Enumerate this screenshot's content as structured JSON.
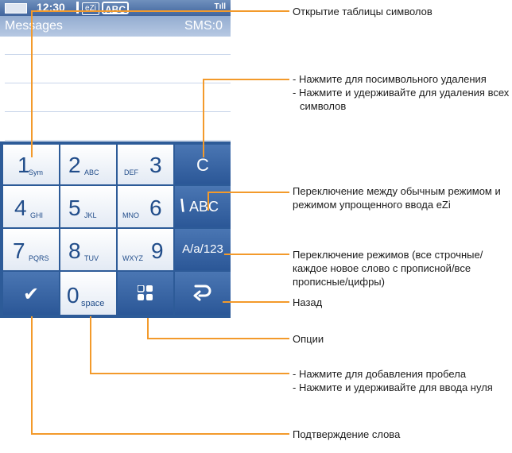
{
  "phone": {
    "status": {
      "time": "12:30",
      "ezi_badge": "eZi",
      "input_mode_badge": "ABC",
      "signal": "Tıll"
    },
    "message_bar": {
      "title": "Messages",
      "sms_counter": "SMS:0"
    }
  },
  "keypad": {
    "keys": [
      {
        "digit": "1",
        "letters": "Sym"
      },
      {
        "digit": "2",
        "letters": "ABC"
      },
      {
        "digit": "3",
        "letters": "DEF"
      },
      {
        "digit": "4",
        "letters": "GHI"
      },
      {
        "digit": "5",
        "letters": "JKL"
      },
      {
        "digit": "6",
        "letters": "MNO"
      },
      {
        "digit": "7",
        "letters": "PQRS"
      },
      {
        "digit": "8",
        "letters": "TUV"
      },
      {
        "digit": "9",
        "letters": "WXYZ"
      },
      {
        "digit": "0",
        "letters": "space"
      }
    ],
    "clear_label": "C",
    "ezi_toggle_label": "ABC",
    "case_mode_label": "A/a/123"
  },
  "callouts": {
    "symbols_table": "Открытие таблицы символов",
    "delete": [
      "- Нажмите для посимвольного удаления",
      "- Нажмите и удерживайте для удаления всех",
      "символов"
    ],
    "ezi_toggle": [
      "Переключение между обычным режимом и",
      "режимом упрощенного ввода eZi"
    ],
    "case_mode": [
      "Переключение режимов (все строчные/",
      "каждое новое слово с прописной/все",
      "прописные/цифры)"
    ],
    "back": "Назад",
    "options": "Опции",
    "space": [
      "- Нажмите для добавления пробела",
      "- Нажмите и удерживайте для ввода нуля"
    ],
    "confirm": "Подтверждение слова"
  },
  "colors": {
    "accent": "#f39a2b",
    "keypad_blue": "#2d5b98",
    "key_text": "#214d8a"
  }
}
